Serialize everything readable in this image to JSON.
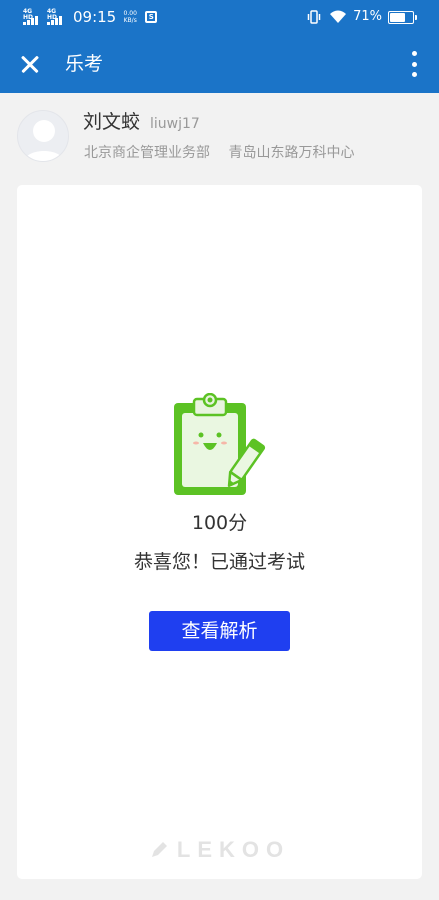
{
  "status_bar": {
    "signal_1_label": "4G HD",
    "signal_2_label": "4G HD",
    "time": "09:15",
    "net_speed_value": "0.00",
    "net_speed_unit": "KB/s",
    "battery_percent_text": "71%",
    "battery_level": 0.71,
    "icons": [
      "signal-icon",
      "app-notification-icon",
      "vibrate-icon",
      "wifi-icon",
      "battery-icon"
    ]
  },
  "app_bar": {
    "title": "乐考",
    "close_icon": "close-icon",
    "more_icon": "more-vertical-icon"
  },
  "user": {
    "name": "刘文蛟",
    "id": "liuwj17",
    "department": "北京商企管理业务部",
    "location": "青岛山东路万科中心"
  },
  "result": {
    "score": "100分",
    "message": "恭喜您！已通过考试",
    "view_analysis_label": "查看解析"
  },
  "brand": {
    "logo_text": "LEKOO"
  },
  "colors": {
    "header_blue": "#1b74c8",
    "button_blue": "#1f3ff0",
    "clipboard_green": "#5cc224",
    "page_background": "#f2f2f2"
  }
}
